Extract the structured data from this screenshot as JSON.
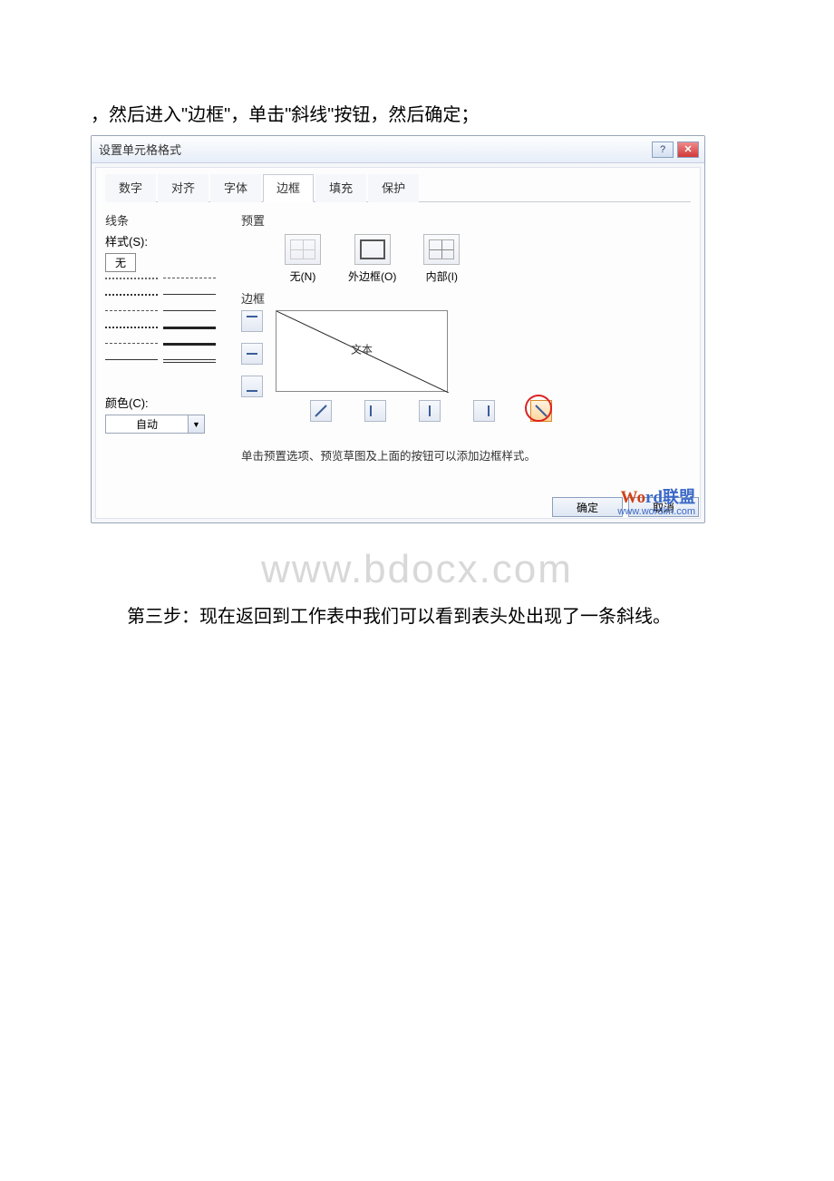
{
  "intro_text": "，然后进入\"边框\"，单击\"斜线\"按钮，然后确定；",
  "big_watermark": "www.bdocx.com",
  "step3_text": "第三步：现在返回到工作表中我们可以看到表头处出现了一条斜线。",
  "dialog": {
    "title": "设置单元格格式",
    "help_symbol": "?",
    "close_symbol": "✕",
    "tabs": [
      "数字",
      "对齐",
      "字体",
      "边框",
      "填充",
      "保护"
    ],
    "active_tab": "边框",
    "line_group": "线条",
    "style_label": "样式(S):",
    "style_none": "无",
    "color_label": "颜色(C):",
    "color_auto": "自动",
    "preset_group": "预置",
    "presets": {
      "none": "无(N)",
      "outer": "外边框(O)",
      "inner": "内部(I)"
    },
    "border_group": "边框",
    "preview_text": "文本",
    "help_line": "单击预置选项、预览草图及上面的按钮可以添加边框样式。",
    "ok": "确定",
    "cancel": "取消"
  },
  "wm": {
    "word_left": "Wo",
    "word_right": "rd",
    "lianmeng": "联盟",
    "url": "www.wordlm.com"
  }
}
